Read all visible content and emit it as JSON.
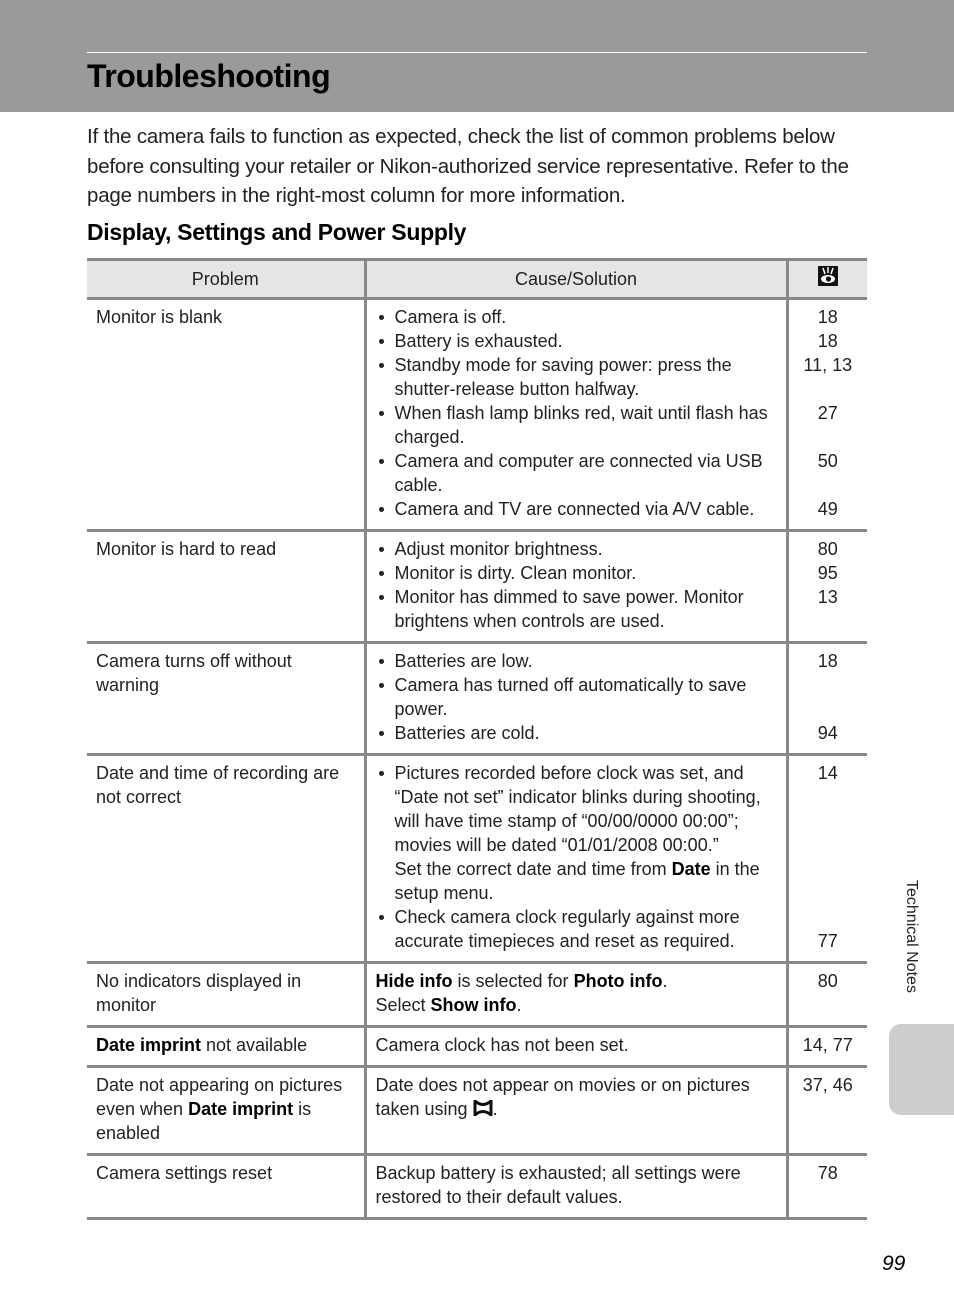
{
  "page": {
    "title": "Troubleshooting",
    "intro": "If the camera fails to function as expected, check the list of common problems below before consulting your retailer or Nikon-authorized service representative. Refer to the page numbers in the right-most column for more information.",
    "section_title": "Display, Settings and Power Supply",
    "side_tab_label": "Technical Notes",
    "page_number": "99"
  },
  "table": {
    "headers": {
      "problem": "Problem",
      "cause": "Cause/Solution",
      "ref_icon": "eye-icon"
    },
    "rows": [
      {
        "problem": "Monitor is blank",
        "items": [
          {
            "text": "Camera is off.",
            "ref": "18",
            "lines": 1
          },
          {
            "text": "Battery is exhausted.",
            "ref": "18",
            "lines": 1
          },
          {
            "text": "Standby mode for saving power: press the shutter-release button halfway.",
            "ref": "11, 13",
            "lines": 2
          },
          {
            "text": "When flash lamp blinks red, wait until flash has charged.",
            "ref": "27",
            "lines": 2
          },
          {
            "text": "Camera and computer are connected via USB cable.",
            "ref": "50",
            "lines": 2
          },
          {
            "text": "Camera and TV are connected via A/V cable.",
            "ref": "49",
            "lines": 1
          }
        ]
      },
      {
        "problem": "Monitor is hard to read",
        "items": [
          {
            "text": "Adjust monitor brightness.",
            "ref": "80",
            "lines": 1
          },
          {
            "text": "Monitor is dirty. Clean monitor.",
            "ref": "95",
            "lines": 1
          },
          {
            "text": "Monitor has dimmed to save power. Monitor brightens when controls are used.",
            "ref": "13",
            "lines": 2
          }
        ]
      },
      {
        "problem": "Camera turns off without warning",
        "items": [
          {
            "text": "Batteries are low.",
            "ref": "18",
            "lines": 1
          },
          {
            "text": "Camera has turned off automatically to save power.",
            "ref": "",
            "lines": 2
          },
          {
            "text": "Batteries are cold.",
            "ref": "94",
            "lines": 1
          }
        ]
      },
      {
        "problem": "Date and time of recording are not correct",
        "items": [
          {
            "text_parts": [
              {
                "t": "Pictures recorded before clock was set, and “Date not set” indicator blinks during shooting, will have time stamp of “00/00/0000 00:00”; movies will be dated “01/01/2008 00:00.”",
                "br_after": true
              },
              {
                "t": "Set the correct date and time from "
              },
              {
                "t": "Date",
                "b": true
              },
              {
                "t": " in the setup menu."
              }
            ],
            "ref": "14",
            "lines": 6
          },
          {
            "text": "Check camera clock regularly against more accurate timepieces and reset as required.",
            "ref": "77",
            "lines": 2,
            "ref_bottom": true
          }
        ]
      },
      {
        "problem": "No indicators displayed in monitor",
        "cause_parts": [
          {
            "t": "Hide info",
            "b": true
          },
          {
            "t": " is selected for "
          },
          {
            "t": "Photo info",
            "b": true
          },
          {
            "t": ".",
            "br_after": true
          },
          {
            "t": "Select "
          },
          {
            "t": "Show info",
            "b": true
          },
          {
            "t": "."
          }
        ],
        "ref": "80"
      },
      {
        "problem_parts": [
          {
            "t": "Date imprint",
            "b": true
          },
          {
            "t": " not available"
          }
        ],
        "cause": "Camera clock has not been set.",
        "ref": "14, 77"
      },
      {
        "problem_parts": [
          {
            "t": "Date not appearing on pictures even when "
          },
          {
            "t": "Date imprint",
            "b": true
          },
          {
            "t": " is enabled"
          }
        ],
        "cause_parts": [
          {
            "t": "Date does not appear on movies or on pictures taken using "
          },
          {
            "icon": "panorama-assist-icon"
          },
          {
            "t": "."
          }
        ],
        "ref": "37, 46"
      },
      {
        "problem": "Camera settings reset",
        "cause": "Backup battery is exhausted; all settings were restored to their default values.",
        "ref": "78"
      }
    ]
  }
}
